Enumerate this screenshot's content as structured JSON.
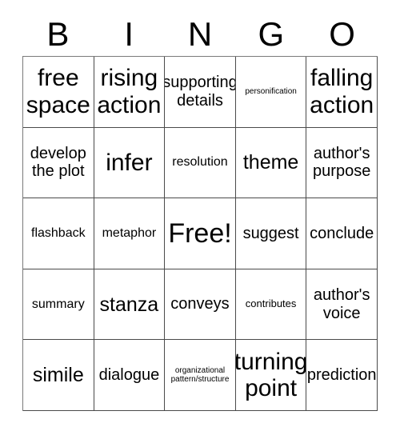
{
  "card": {
    "title": "BINGO",
    "header_letters": [
      "B",
      "I",
      "N",
      "G",
      "O"
    ],
    "grid_size": "5x5",
    "free_space_label": "Free!",
    "rows": [
      [
        {
          "text": "free\nspace",
          "size": "xl"
        },
        {
          "text": "rising\naction",
          "size": "xl"
        },
        {
          "text": "supporting\ndetails",
          "size": "md"
        },
        {
          "text": "personification",
          "size": "xxs"
        },
        {
          "text": "falling\naction",
          "size": "xl"
        }
      ],
      [
        {
          "text": "develop\nthe plot",
          "size": "md"
        },
        {
          "text": "infer",
          "size": "xl"
        },
        {
          "text": "resolution",
          "size": "sm"
        },
        {
          "text": "theme",
          "size": "lg"
        },
        {
          "text": "author's\npurpose",
          "size": "md"
        }
      ],
      [
        {
          "text": "flashback",
          "size": "sm"
        },
        {
          "text": "metaphor",
          "size": "sm"
        },
        {
          "text": "Free!",
          "size": "xxl"
        },
        {
          "text": "suggest",
          "size": "md"
        },
        {
          "text": "conclude",
          "size": "md"
        }
      ],
      [
        {
          "text": "summary",
          "size": "sm"
        },
        {
          "text": "stanza",
          "size": "lg"
        },
        {
          "text": "conveys",
          "size": "md"
        },
        {
          "text": "contributes",
          "size": "xs"
        },
        {
          "text": "author's\nvoice",
          "size": "md"
        }
      ],
      [
        {
          "text": "simile",
          "size": "lg"
        },
        {
          "text": "dialogue",
          "size": "md"
        },
        {
          "text": "organizational\npattern/structure",
          "size": "xxs"
        },
        {
          "text": "turning\npoint",
          "size": "xl"
        },
        {
          "text": "prediction",
          "size": "md"
        }
      ]
    ]
  },
  "colors": {
    "background": "#ffffff",
    "text": "#000000",
    "grid_line": "#4a4a4a"
  }
}
